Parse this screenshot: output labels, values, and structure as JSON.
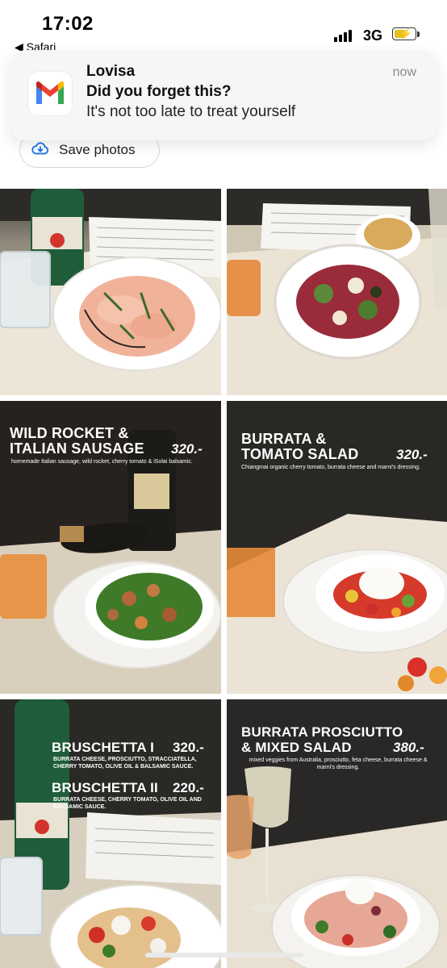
{
  "status_bar": {
    "time": "17:02",
    "back_app": "◀ Safari",
    "network": "3G",
    "battery_level": 0.6
  },
  "notification": {
    "sender": "Lovisa",
    "time": "now",
    "subject": "Did you forget this?",
    "body": "It's not too late to treat yourself",
    "app_icon": "gmail-icon"
  },
  "toolbar": {
    "save_label": "Save photos",
    "save_icon": "cloud-download-icon"
  },
  "menu": [
    {
      "name": "photo-carpaccio"
    },
    {
      "name": "photo-salad"
    },
    {
      "title_line1": "WILD ROCKET &",
      "title_line2": "ITALIAN SAUSAGE",
      "price": "320.-",
      "description": "homemade Italian sausage, wild rocket, cherry tomato & iSolai balsamic."
    },
    {
      "title_line1": "BURRATA &",
      "title_line2": "TOMATO SALAD",
      "price": "320.-",
      "description": "Chiangmai organic cherry tomato, burrata cheese and marni's dressing."
    },
    {
      "title_a": "BRUSCHETTA I",
      "price_a": "320.-",
      "desc_a": "BURRATA CHEESE, PROSCIUTTO, STRACCIATELLA, CHERRY TOMATO, OLIVE OIL &  BALSAMIC SAUCE.",
      "title_b": "BRUSCHETTA II",
      "price_b": "220.-",
      "desc_b": "BURRATA CHEESE, CHERRY TOMATO, OLIVE OIL AND BALSAMIC SAUCE."
    },
    {
      "title_line1": "BURRATA  PROSCIUTTO",
      "title_line2": "& MIXED SALAD",
      "price": "380.-",
      "description": "mixed veggies from Australia, prosciutto, feta cheese, burrata cheese & marni's dressing."
    }
  ],
  "colors": {
    "accent_blue": "#1a73e8",
    "photo_dark": "#2c2b28",
    "linen": "#e9e3d6",
    "plate": "#f4f2ee"
  }
}
